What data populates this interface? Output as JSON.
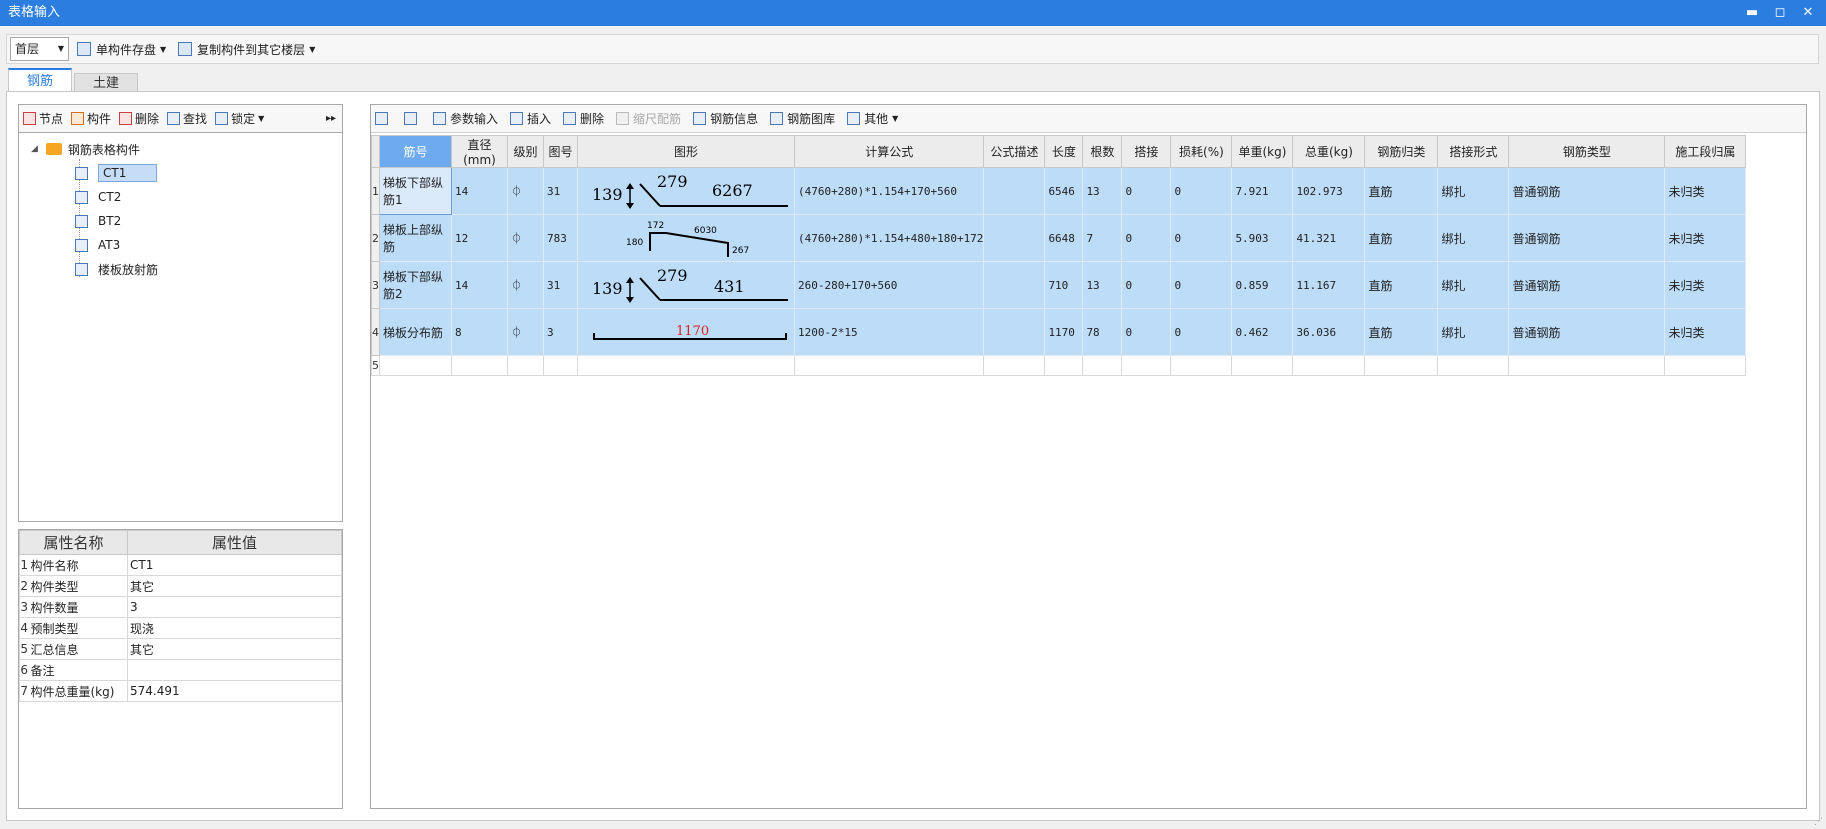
{
  "window": {
    "title": "表格输入",
    "min": "▬",
    "max": "◻",
    "close": "✕"
  },
  "toolbar": {
    "floor": "首层",
    "save_label": "单构件存盘",
    "copy_label": "复制构件到其它楼层"
  },
  "tabs": [
    {
      "label": "钢筋"
    },
    {
      "label": "土建"
    }
  ],
  "left_toolbar": {
    "node": "节点",
    "component": "构件",
    "delete": "删除",
    "find": "查找",
    "lock": "锁定",
    "expand": "▸▸"
  },
  "tree": {
    "root": "钢筋表格构件",
    "items": [
      {
        "label": "CT1"
      },
      {
        "label": "CT2"
      },
      {
        "label": "BT2"
      },
      {
        "label": "AT3"
      },
      {
        "label": "楼板放射筋"
      }
    ]
  },
  "properties": {
    "headers": {
      "name": "属性名称",
      "value": "属性值"
    },
    "rows": [
      {
        "n": "1",
        "name": "构件名称",
        "value": "CT1"
      },
      {
        "n": "2",
        "name": "构件类型",
        "value": "其它"
      },
      {
        "n": "3",
        "name": "构件数量",
        "value": "3"
      },
      {
        "n": "4",
        "name": "预制类型",
        "value": "现浇"
      },
      {
        "n": "5",
        "name": "汇总信息",
        "value": "其它"
      },
      {
        "n": "6",
        "name": "备注",
        "value": ""
      },
      {
        "n": "7",
        "name": "构件总重量(kg)",
        "value": "574.491"
      }
    ]
  },
  "right_toolbar": {
    "param_input": "参数输入",
    "insert": "插入",
    "delete": "删除",
    "scale": "缩尺配筋",
    "info": "钢筋信息",
    "library": "钢筋图库",
    "other": "其他"
  },
  "grid": {
    "headers": [
      "筋号",
      "直径(mm)",
      "级别",
      "图号",
      "图形",
      "计算公式",
      "公式描述",
      "长度",
      "根数",
      "搭接",
      "损耗(%)",
      "单重(kg)",
      "总重(kg)",
      "钢筋归类",
      "搭接形式",
      "钢筋类型",
      "施工段归属"
    ],
    "grade_symbol": "⏀",
    "rows": [
      {
        "n": "1",
        "name": "梯板下部纵筋1",
        "dia": "14",
        "no": "31",
        "formula": "(4760+280)*1.154+170+560",
        "desc": "",
        "len": "6546",
        "count": "13",
        "lap": "0",
        "loss": "0",
        "unit": "7.921",
        "total": "102.973",
        "cls": "直筋",
        "lapform": "绑扎",
        "type": "普通钢筋",
        "seg": "未归类",
        "fig": {
          "a": "139",
          "b": "279",
          "c": "6267"
        }
      },
      {
        "n": "2",
        "name": "梯板上部纵筋",
        "dia": "12",
        "no": "783",
        "formula": "(4760+280)*1.154+480+180+172",
        "desc": "",
        "len": "6648",
        "count": "7",
        "lap": "0",
        "loss": "0",
        "unit": "5.903",
        "total": "41.321",
        "cls": "直筋",
        "lapform": "绑扎",
        "type": "普通钢筋",
        "seg": "未归类",
        "fig": {
          "a": "180",
          "b": "172",
          "c": "6030",
          "d": "267"
        }
      },
      {
        "n": "3",
        "name": "梯板下部纵筋2",
        "dia": "14",
        "no": "31",
        "formula": "260-280+170+560",
        "desc": "",
        "len": "710",
        "count": "13",
        "lap": "0",
        "loss": "0",
        "unit": "0.859",
        "total": "11.167",
        "cls": "直筋",
        "lapform": "绑扎",
        "type": "普通钢筋",
        "seg": "未归类",
        "fig": {
          "a": "139",
          "b": "279",
          "c": "431"
        }
      },
      {
        "n": "4",
        "name": "梯板分布筋",
        "dia": "8",
        "no": "3",
        "formula": "1200-2*15",
        "desc": "",
        "len": "1170",
        "count": "78",
        "lap": "0",
        "loss": "0",
        "unit": "0.462",
        "total": "36.036",
        "cls": "直筋",
        "lapform": "绑扎",
        "type": "普通钢筋",
        "seg": "未归类",
        "fig": {
          "a": "1170"
        }
      }
    ],
    "empty_row": "5"
  }
}
